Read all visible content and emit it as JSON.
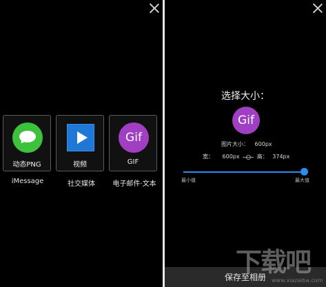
{
  "left_panel": {
    "tiles": [
      {
        "label": "动态PNG",
        "caption": "iMessage",
        "icon": "message-bubble-icon",
        "color": "#3ec23e"
      },
      {
        "label": "视频",
        "caption": "社交媒体",
        "icon": "video-play-icon",
        "color": "#1f78d6"
      },
      {
        "label": "GIF",
        "caption": "电子邮件·文本",
        "icon": "gif-icon",
        "icon_text": "Gif",
        "color": "#a13fc4"
      }
    ]
  },
  "right_panel": {
    "title": "选择大小：",
    "preview_icon_text": "Gif",
    "image_size_label": "图片大小：",
    "image_size_value": "600px",
    "width_label": "宽：",
    "width_value": "600px",
    "height_label": "高：",
    "height_value": "374px",
    "slider": {
      "min_label": "最小值",
      "max_label": "最大值",
      "value_fraction": 1.0
    },
    "save_button": "保存至相册"
  },
  "watermark": {
    "text": "下载吧",
    "url": "www.xiazaiba.com"
  },
  "colors": {
    "accent": "#2a8ff0",
    "background": "#000000"
  }
}
